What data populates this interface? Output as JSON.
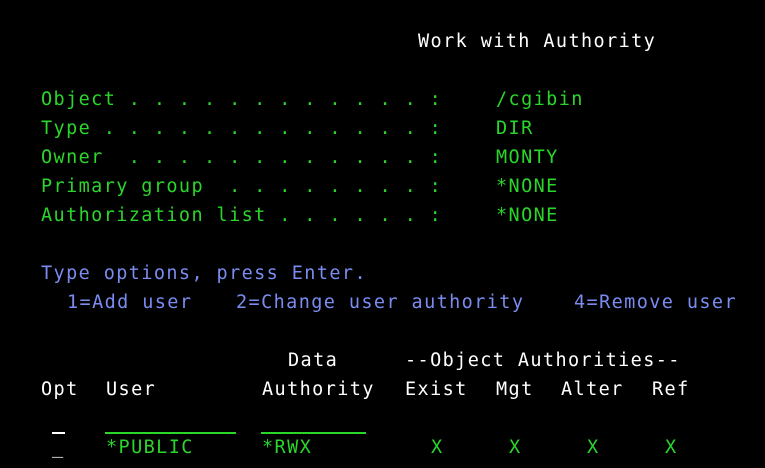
{
  "header": {
    "title": "Work with Authority"
  },
  "object_info": [
    {
      "label": "Object . . . . . . . . . . . . :",
      "value": "/cgibin"
    },
    {
      "label": "Type . . . . . . . . . . . . . :",
      "value": "DIR"
    },
    {
      "label": "Owner  . . . . . . . . . . . . :",
      "value": "MONTY"
    },
    {
      "label": "Primary group  . . . . . . . . :",
      "value": "*NONE"
    },
    {
      "label": "Authorization list . . . . . . :",
      "value": "*NONE"
    }
  ],
  "instructions": {
    "prompt": "Type options, press Enter.",
    "options": [
      "1=Add user",
      "2=Change user authority",
      "4=Remove user"
    ]
  },
  "table": {
    "header_data": "Data",
    "header_object_authorities": "--Object Authorities--",
    "col_opt": "Opt",
    "col_user": "User",
    "col_authority": "Authority",
    "col_exist": "Exist",
    "col_mgt": "Mgt",
    "col_alter": "Alter",
    "col_ref": "Ref",
    "rows": [
      {
        "opt": "_",
        "user": "*PUBLIC",
        "authority": "*RWX",
        "exist": "X",
        "mgt": "X",
        "alter": "X",
        "ref": "X"
      }
    ]
  },
  "colors": {
    "background": "#000000",
    "heading": "#ffffff",
    "text": "#2bd62b",
    "instructions": "#7b8cf0"
  }
}
